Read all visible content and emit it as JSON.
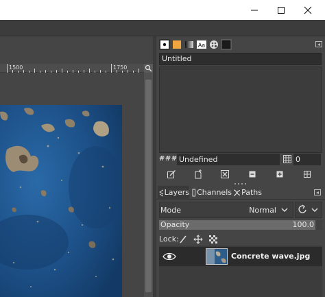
{
  "window": {
    "minimize_icon": "minimize-icon",
    "maximize_icon": "maximize-icon",
    "close_icon": "close-icon"
  },
  "ruler": {
    "tick_labels": [
      "1500",
      "1750"
    ]
  },
  "image_dock": {
    "tabs": [
      "brush-icon",
      "pattern-swatch-icon",
      "gradient-icon",
      "font-icon",
      "palette-icon",
      "color-swatch-icon"
    ],
    "font_tab_label": "Aa",
    "name_value": "Untitled",
    "hash_label": "####",
    "status_value": "Undefined",
    "grid_count": "0"
  },
  "layers_dock": {
    "tabs": [
      {
        "label": "Layers",
        "icon": "layers-icon"
      },
      {
        "label": "Channels",
        "icon": "channels-icon"
      },
      {
        "label": "Paths",
        "icon": "paths-icon"
      }
    ],
    "mode_label": "Mode",
    "mode_value": "Normal",
    "opacity_label": "Opacity",
    "opacity_value": "100.0",
    "opacity_fraction": 1.0,
    "lock_label": "Lock:",
    "layers": [
      {
        "name": "Concrete wave.jpg",
        "visible": true
      }
    ]
  },
  "colors": {
    "panel_bg": "#454545",
    "canvas_image_blue": "#1d4f84",
    "titlebar": "#ffffff"
  }
}
